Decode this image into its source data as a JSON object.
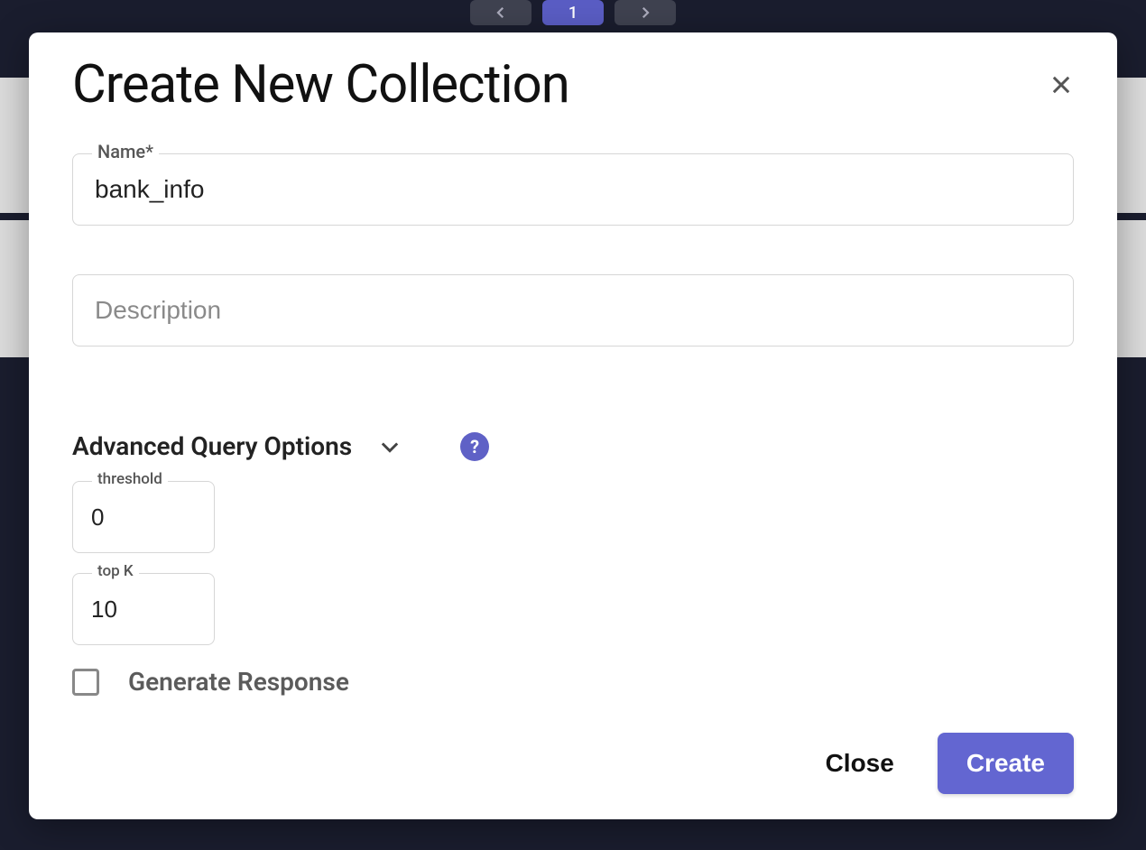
{
  "background": {
    "page_current": "1"
  },
  "modal": {
    "title": "Create New Collection",
    "name_field": {
      "label": "Name*",
      "value": "bank_info"
    },
    "description_field": {
      "placeholder": "Description",
      "value": ""
    },
    "advanced": {
      "label": "Advanced Query Options",
      "help": "?",
      "threshold": {
        "label": "threshold",
        "value": "0"
      },
      "topk": {
        "label": "top K",
        "value": "10"
      },
      "generate_response_label": "Generate Response",
      "generate_response_checked": false
    },
    "footer": {
      "close_label": "Close",
      "create_label": "Create"
    }
  }
}
